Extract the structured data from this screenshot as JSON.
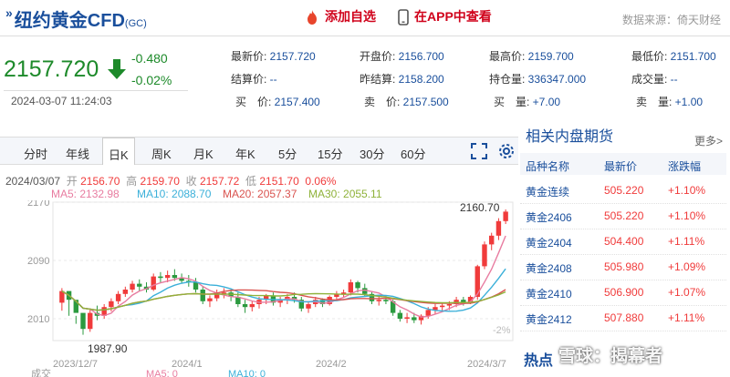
{
  "header": {
    "title": "纽约黄金CFD",
    "symbol": "(GC)",
    "add_fav_label": "添加自选",
    "app_label": "在APP中查看",
    "source": "数据来源：倚天财经"
  },
  "quote": {
    "price": "2157.720",
    "change": "-0.480",
    "change_pct": "-0.02%",
    "timestamp": "2024-03-07 11:24:03",
    "fields": [
      {
        "label": "最新价: ",
        "value": "2157.720"
      },
      {
        "label": "开盘价: ",
        "value": "2156.700"
      },
      {
        "label": "最高价: ",
        "value": "2159.700"
      },
      {
        "label": "最低价: ",
        "value": "2151.700"
      },
      {
        "label": "结算价: ",
        "value": "--"
      },
      {
        "label": "昨结算: ",
        "value": "2158.200"
      },
      {
        "label": "持仓量: ",
        "value": "336347.000"
      },
      {
        "label": "成交量: ",
        "value": "--"
      },
      {
        "label": "买　价: ",
        "value": "2157.400"
      },
      {
        "label": "卖　价: ",
        "value": "2157.500"
      },
      {
        "label": "买　量: ",
        "value": "+7.00"
      },
      {
        "label": "卖　量: ",
        "value": "+1.00"
      }
    ]
  },
  "tabs": [
    "分时",
    "年线",
    "日K",
    "周K",
    "月K",
    "年K",
    "5分",
    "15分",
    "30分",
    "60分"
  ],
  "ohlc": {
    "date": "2024/03/07",
    "open_label": "开",
    "open": "2156.70",
    "high_label": "高",
    "high": "2159.70",
    "close_label": "收",
    "close": "2157.72",
    "low_label": "低",
    "low": "2151.70",
    "pct": "0.06%"
  },
  "ma": [
    {
      "label": "MA5: 2132.98",
      "color": "#e87ca0"
    },
    {
      "label": "MA10: 2088.70",
      "color": "#3bb0d9"
    },
    {
      "label": "MA20: 2057.37",
      "color": "#d9534f"
    },
    {
      "label": "MA30: 2055.11",
      "color": "#8fb23a"
    }
  ],
  "chart_data": {
    "type": "candlestick",
    "y_ticks": [
      "2170",
      "2090",
      "2010"
    ],
    "y_tick_values": [
      2170,
      2090,
      2010
    ],
    "ylim": [
      1970,
      2180
    ],
    "x_ticks": [
      "2023/12/7",
      "2024/1",
      "2024/2",
      "2024/3/7"
    ],
    "high_label": "2160.70",
    "low_label": "1987.90",
    "pct_label": "-2%",
    "candles": [
      [
        2032,
        2052,
        2021,
        2048
      ],
      [
        2048,
        2040,
        2014,
        2036
      ],
      [
        2036,
        2014,
        2003,
        2018
      ],
      [
        2018,
        2000,
        1988,
        1996
      ],
      [
        1996,
        2022,
        1992,
        2018
      ],
      [
        2018,
        2028,
        2008,
        2014
      ],
      [
        2014,
        2030,
        2010,
        2026
      ],
      [
        2026,
        2038,
        2020,
        2034
      ],
      [
        2034,
        2048,
        2030,
        2044
      ],
      [
        2044,
        2054,
        2040,
        2050
      ],
      [
        2050,
        2062,
        2046,
        2058
      ],
      [
        2058,
        2064,
        2048,
        2054
      ],
      [
        2054,
        2060,
        2046,
        2050
      ],
      [
        2050,
        2072,
        2048,
        2068
      ],
      [
        2068,
        2074,
        2060,
        2066
      ],
      [
        2066,
        2076,
        2060,
        2070
      ],
      [
        2070,
        2078,
        2062,
        2066
      ],
      [
        2066,
        2072,
        2058,
        2062
      ],
      [
        2062,
        2070,
        2054,
        2060
      ],
      [
        2060,
        2066,
        2046,
        2050
      ],
      [
        2050,
        2054,
        2030,
        2034
      ],
      [
        2034,
        2042,
        2026,
        2038
      ],
      [
        2038,
        2050,
        2034,
        2044
      ],
      [
        2044,
        2052,
        2038,
        2046
      ],
      [
        2046,
        2050,
        2034,
        2040
      ],
      [
        2040,
        2046,
        2026,
        2030
      ],
      [
        2030,
        2036,
        2018,
        2026
      ],
      [
        2026,
        2034,
        2020,
        2030
      ],
      [
        2030,
        2040,
        2024,
        2036
      ],
      [
        2036,
        2044,
        2030,
        2042
      ],
      [
        2042,
        2046,
        2028,
        2032
      ],
      [
        2032,
        2040,
        2026,
        2036
      ],
      [
        2036,
        2044,
        2030,
        2040
      ],
      [
        2040,
        2046,
        2032,
        2036
      ],
      [
        2036,
        2040,
        2020,
        2024
      ],
      [
        2024,
        2034,
        2018,
        2030
      ],
      [
        2030,
        2040,
        2026,
        2036
      ],
      [
        2036,
        2038,
        2026,
        2030
      ],
      [
        2030,
        2042,
        2028,
        2040
      ],
      [
        2040,
        2048,
        2036,
        2044
      ],
      [
        2044,
        2050,
        2040,
        2046
      ],
      [
        2046,
        2064,
        2042,
        2060
      ],
      [
        2060,
        2062,
        2046,
        2052
      ],
      [
        2052,
        2058,
        2040,
        2044
      ],
      [
        2044,
        2048,
        2030,
        2034
      ],
      [
        2034,
        2040,
        2028,
        2036
      ],
      [
        2036,
        2042,
        2030,
        2034
      ],
      [
        2034,
        2036,
        2014,
        2018
      ],
      [
        2018,
        2022,
        2006,
        2010
      ],
      [
        2010,
        2018,
        2004,
        2012
      ],
      [
        2012,
        2018,
        2004,
        2008
      ],
      [
        2008,
        2016,
        2002,
        2014
      ],
      [
        2014,
        2026,
        2010,
        2022
      ],
      [
        2022,
        2030,
        2016,
        2026
      ],
      [
        2026,
        2032,
        2020,
        2028
      ],
      [
        2028,
        2034,
        2022,
        2030
      ],
      [
        2030,
        2040,
        2026,
        2036
      ],
      [
        2036,
        2040,
        2028,
        2032
      ],
      [
        2032,
        2042,
        2030,
        2040
      ],
      [
        2040,
        2084,
        2036,
        2082
      ],
      [
        2082,
        2116,
        2078,
        2112
      ],
      [
        2112,
        2128,
        2104,
        2124
      ],
      [
        2124,
        2148,
        2118,
        2144
      ],
      [
        2144,
        2160,
        2140,
        2157
      ]
    ]
  },
  "bottom": {
    "vol_label": "成交",
    "ma5": "MA5: 0",
    "ma10": "MA10: 0"
  },
  "side": {
    "title": "相关内盘期货",
    "more": "更多>",
    "headers": [
      "品种名称",
      "最新价",
      "涨跌幅"
    ],
    "rows": [
      {
        "name": "黄金连续",
        "price": "505.220",
        "pct": "+1.10%"
      },
      {
        "name": "黄金2406",
        "price": "505.220",
        "pct": "+1.10%"
      },
      {
        "name": "黄金2404",
        "price": "504.400",
        "pct": "+1.11%"
      },
      {
        "name": "黄金2408",
        "price": "505.980",
        "pct": "+1.09%"
      },
      {
        "name": "黄金2410",
        "price": "506.900",
        "pct": "+1.07%"
      },
      {
        "name": "黄金2412",
        "price": "507.880",
        "pct": "+1.11%"
      }
    ],
    "hot_title": "热点",
    "watermark": "雪球：揭幕者"
  }
}
